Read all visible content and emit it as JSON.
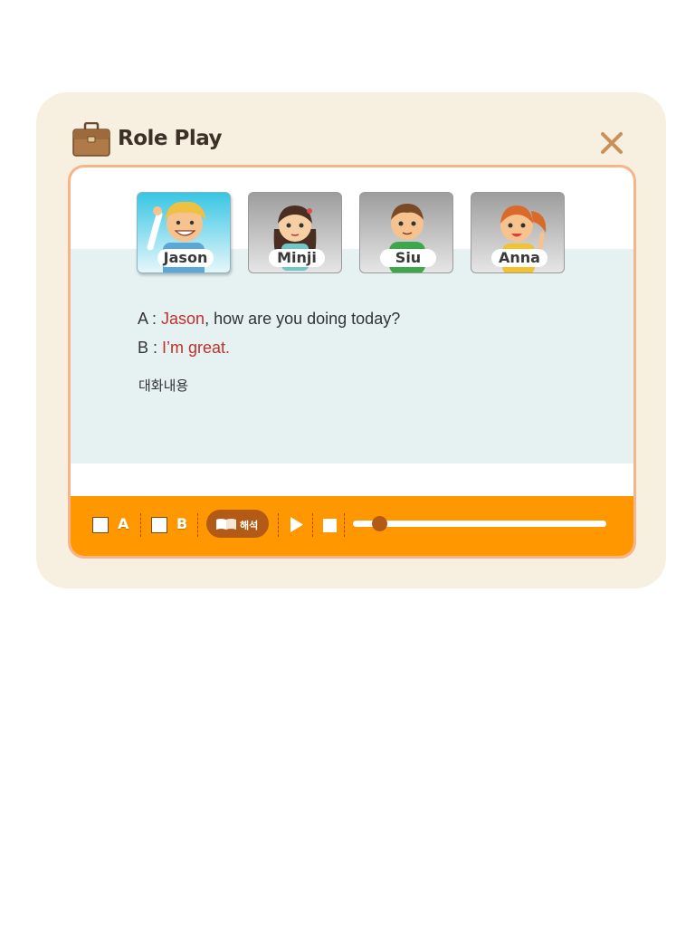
{
  "window": {
    "title": "Role Play"
  },
  "characters": [
    {
      "name": "Jason",
      "selected": true
    },
    {
      "name": "Minji",
      "selected": false
    },
    {
      "name": "Siu",
      "selected": false
    },
    {
      "name": "Anna",
      "selected": false
    }
  ],
  "dialog": {
    "line_a": {
      "speaker": "A : ",
      "highlight": "Jason",
      "rest": ", how are you doing today?"
    },
    "line_b": {
      "speaker": "B : ",
      "highlight": "I’m great",
      "rest": "."
    },
    "translation": "대화내용"
  },
  "controls": {
    "checkbox_a_label": "A",
    "checkbox_b_label": "B",
    "translate_label": "해석",
    "progress": 0.1
  },
  "colors": {
    "accent": "#ff9800",
    "highlight": "#c0302c",
    "panel_bg": "#f7efe0",
    "content_bg": "#e6f1f1"
  }
}
